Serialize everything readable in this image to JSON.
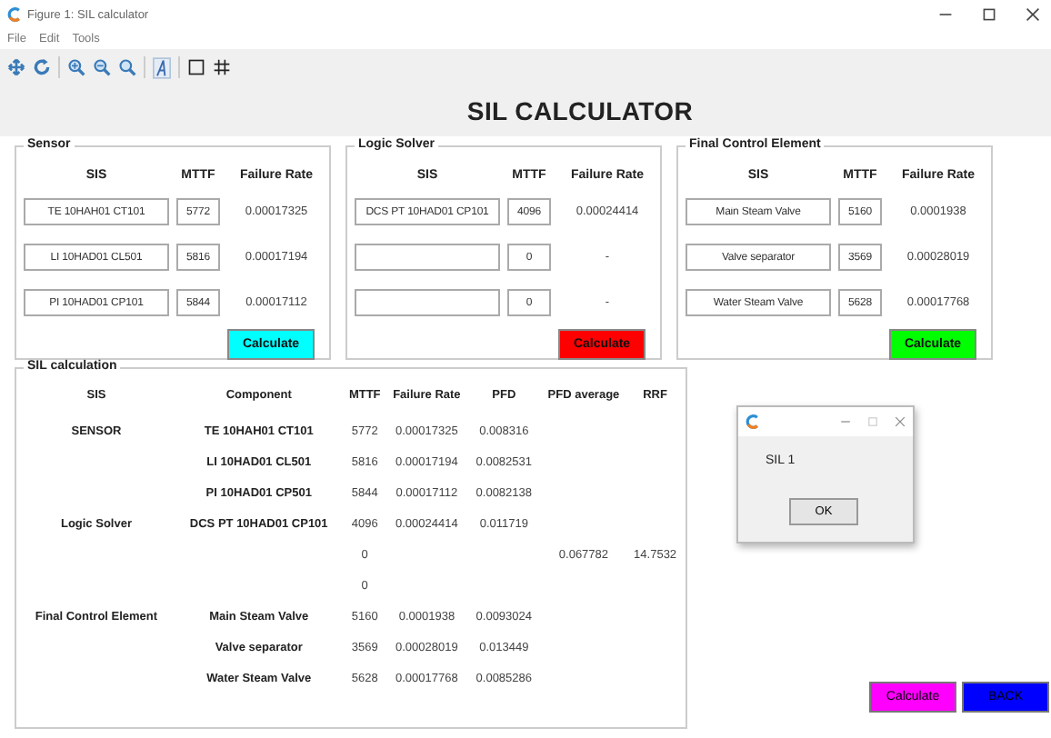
{
  "window": {
    "title": "Figure 1: SIL calculator"
  },
  "menu": [
    "File",
    "Edit",
    "Tools"
  ],
  "heading": "SIL CALCULATOR",
  "groups": [
    {
      "title": "Sensor",
      "columns": [
        "SIS",
        "MTTF",
        "Failure Rate"
      ],
      "button": {
        "label": "Calculate",
        "color": "#00ffff"
      },
      "rows": [
        {
          "sis": "TE 10HAH01 CT101",
          "mttf": "5772",
          "rate": "0.00017325"
        },
        {
          "sis": "LI 10HAD01 CL501",
          "mttf": "5816",
          "rate": "0.00017194"
        },
        {
          "sis": "PI 10HAD01 CP101",
          "mttf": "5844",
          "rate": "0.00017112"
        }
      ]
    },
    {
      "title": "Logic Solver",
      "columns": [
        "SIS",
        "MTTF",
        "Failure Rate"
      ],
      "button": {
        "label": "Calculate",
        "color": "#ff0000"
      },
      "rows": [
        {
          "sis": "DCS PT 10HAD01 CP101",
          "mttf": "4096",
          "rate": "0.00024414"
        },
        {
          "mttf": "0",
          "rate": "-"
        },
        {
          "mttf": "0",
          "rate": "-"
        }
      ]
    },
    {
      "title": "Final Control Element",
      "columns": [
        "SIS",
        "MTTF",
        "Failure Rate"
      ],
      "button": {
        "label": "Calculate",
        "color": "#00ff00"
      },
      "rows": [
        {
          "sis": "Main Steam Valve",
          "mttf": "5160",
          "rate": "0.0001938"
        },
        {
          "sis": "Valve separator",
          "mttf": "3569",
          "rate": "0.00028019"
        },
        {
          "sis": "Water Steam Valve",
          "mttf": "5628",
          "rate": "0.00017768"
        }
      ]
    }
  ],
  "sil": {
    "title": "SIL calculation",
    "columns": [
      "SIS",
      "Component",
      "MTTF",
      "Failure Rate",
      "PFD",
      "PFD average",
      "RRF"
    ],
    "rows": [
      [
        "SENSOR",
        "TE 10HAH01 CT101",
        "5772",
        "0.00017325",
        "0.008316",
        "",
        ""
      ],
      [
        "",
        "LI 10HAD01 CL501",
        "5816",
        "0.00017194",
        "0.0082531",
        "",
        ""
      ],
      [
        "",
        "PI 10HAD01 CP501",
        "5844",
        "0.00017112",
        "0.0082138",
        "",
        ""
      ],
      [
        "Logic Solver",
        "DCS PT 10HAD01 CP101",
        "4096",
        "0.00024414",
        "0.011719",
        "",
        ""
      ],
      [
        "",
        "",
        "0",
        "",
        "",
        "0.067782",
        "14.7532"
      ],
      [
        "",
        "",
        "0",
        "",
        "",
        "",
        ""
      ],
      [
        "Final Control Element",
        "Main Steam Valve",
        "5160",
        "0.0001938",
        "0.0093024",
        "",
        ""
      ],
      [
        "",
        "Valve separator",
        "3569",
        "0.00028019",
        "0.013449",
        "",
        ""
      ],
      [
        "",
        "Water Steam Valve",
        "5628",
        "0.00017768",
        "0.0085286",
        "",
        ""
      ]
    ]
  },
  "bottom_buttons": [
    {
      "label": "Calculate",
      "color": "#ff00ff"
    },
    {
      "label": "BACK",
      "color": "#0000ff"
    }
  ],
  "dialog": {
    "message": "SIL 1",
    "button": "OK"
  }
}
